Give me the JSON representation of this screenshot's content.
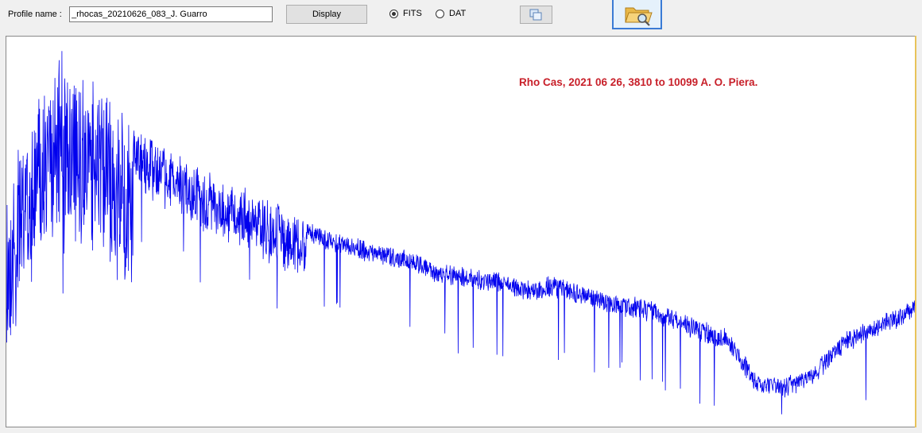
{
  "toolbar": {
    "profile_label": "Profile name :",
    "profile_value": "_rhocas_20210626_083_J. Guarro",
    "display_label": "Display",
    "format_options": [
      {
        "label": "FITS",
        "selected": true
      },
      {
        "label": "DAT",
        "selected": false
      }
    ],
    "copy_icon": "copy-icon",
    "open_icon": "open-folder-search-icon"
  },
  "plot": {
    "title": "Rho Cas, 2021 06 26, 3810 to 10099 A. O. Piera.",
    "line_color": "#0000ee",
    "title_color": "#c8202a"
  },
  "chart_data": {
    "type": "line",
    "title": "Rho Cas, 2021 06 26, 3810 to 10099 A. O. Piera.",
    "xlabel": "",
    "ylabel": "",
    "grid": false,
    "xlim": [
      3810,
      10099
    ],
    "series": [
      {
        "x": [
          3810,
          4000,
          4200,
          4400,
          4600,
          4800,
          5000,
          5200,
          5400,
          5600,
          5800,
          6000,
          6200,
          6400,
          6600,
          6800,
          7000,
          7200,
          7400,
          7600,
          7800,
          8000,
          8200,
          8400,
          8600,
          8800,
          9000,
          9200,
          9400,
          9600,
          9800,
          10099
        ],
        "values": [
          0.5,
          0.72,
          0.8,
          0.75,
          0.68,
          0.63,
          0.59,
          0.55,
          0.52,
          0.49,
          0.46,
          0.43,
          0.41,
          0.39,
          0.38,
          0.35,
          0.34,
          0.33,
          0.31,
          0.32,
          0.3,
          0.28,
          0.27,
          0.25,
          0.22,
          0.2,
          0.1,
          0.09,
          0.12,
          0.19,
          0.22,
          0.27
        ]
      }
    ]
  }
}
